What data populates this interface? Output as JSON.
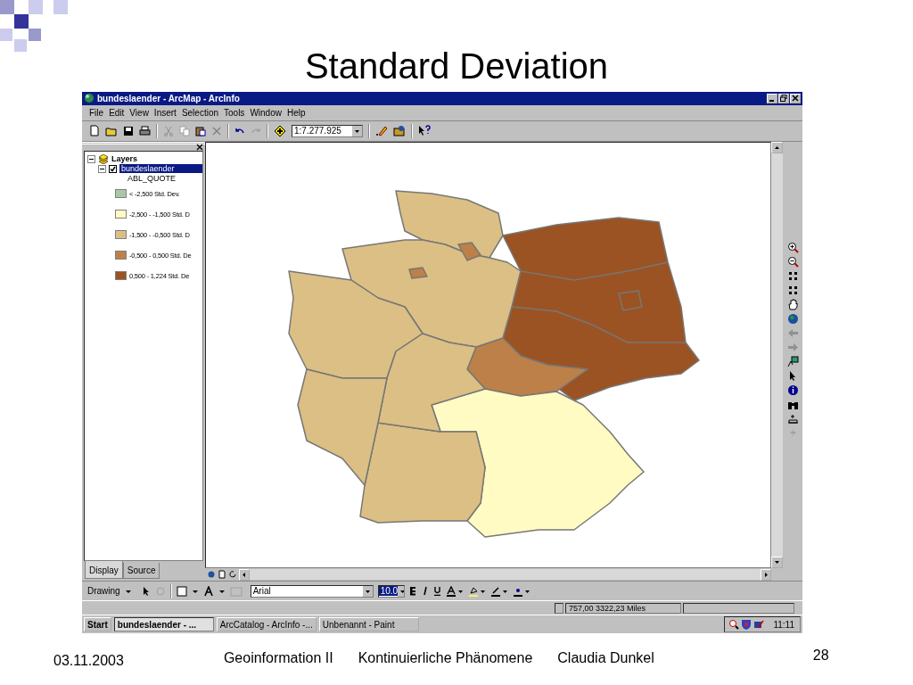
{
  "slide": {
    "title": "Standard Deviation"
  },
  "window": {
    "title": "bundeslaender - ArcMap - ArcInfo"
  },
  "menu": [
    "File",
    "Edit",
    "View",
    "Insert",
    "Selection",
    "Tools",
    "Window",
    "Help"
  ],
  "toolbar": {
    "scale": "1:7.277.925"
  },
  "toc": {
    "root": "Layers",
    "layer": {
      "name": "bundeslaender",
      "checked": true
    },
    "field": "ABL_QUOTE",
    "classes": [
      {
        "label": "< -2,500 Std. Dev.",
        "color": "#a9c9a4"
      },
      {
        "label": "-2,500 - -1,500 Std. D",
        "color": "#fffbc2"
      },
      {
        "label": "-1,500 - -0,500 Std. D",
        "color": "#dcbf84"
      },
      {
        "label": "-0,500 - 0,500 Std. De",
        "color": "#bd8048"
      },
      {
        "label": "0,500 - 1,224 Std. De",
        "color": "#9b5323"
      }
    ],
    "tabs": [
      {
        "label": "Display",
        "selected": true
      },
      {
        "label": "Source",
        "selected": false
      }
    ]
  },
  "drawing_toolbar": {
    "menu": "Drawing",
    "font": "Arial",
    "size": "10.0"
  },
  "status_bar": {
    "coordinates": "757,00  3322,23 Miles"
  },
  "taskbar": {
    "start": "Start",
    "tasks": [
      {
        "label": "bundeslaender - ...",
        "selected": true
      },
      {
        "label": "ArcCatalog - ArcInfo -...",
        "selected": false
      },
      {
        "label": "Unbenannt - Paint",
        "selected": false
      }
    ],
    "clock": "11:11"
  },
  "footer": {
    "date": "03.11.2003",
    "course": "Geoinformation II",
    "topic": "Kontinuierliche Phänomene",
    "author": "Claudia Dunkel",
    "page": "28"
  }
}
